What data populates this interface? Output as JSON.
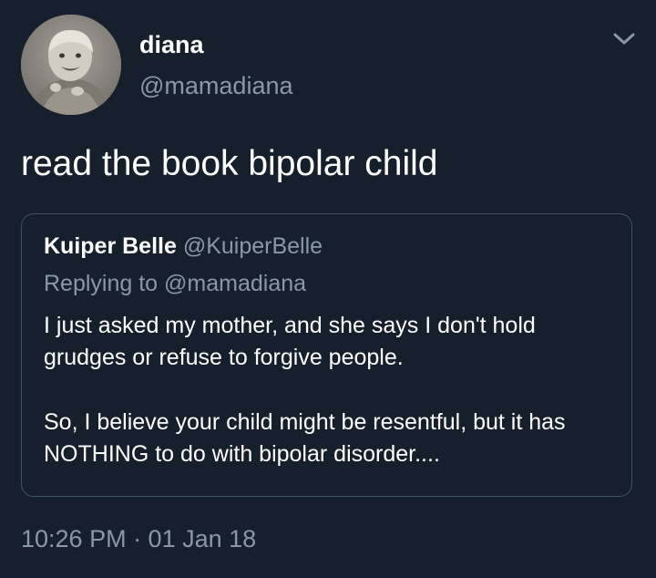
{
  "author": {
    "display_name": "diana",
    "handle": "@mamadiana",
    "avatar_icon": "profile-photo"
  },
  "menu": {
    "icon": "chevron-down-icon"
  },
  "tweet": {
    "text": "read the book bipolar child",
    "timestamp": "10:26 PM · 01 Jan 18"
  },
  "quoted_tweet": {
    "display_name": "Kuiper Belle",
    "handle": "@KuiperBelle",
    "replying_prefix": "Replying to",
    "replying_to": "@mamadiana",
    "paragraphs": [
      "I just asked my mother, and she says I don't hold grudges or refuse to forgive people.",
      "So, I believe your child might be resentful, but it has NOTHING to do with bipolar disorder...."
    ]
  },
  "colors": {
    "background": "#16202c",
    "primary_text": "#ffffff",
    "secondary_text": "#8899a6",
    "quote_border": "#3d5466"
  }
}
